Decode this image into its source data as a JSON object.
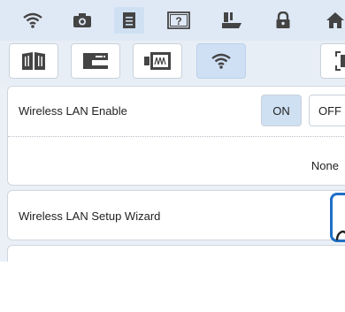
{
  "tabs": [
    {
      "icon": "wifi-icon",
      "active": false
    },
    {
      "icon": "camera-icon",
      "active": false
    },
    {
      "icon": "document-icon",
      "active": true
    },
    {
      "icon": "help-icon",
      "active": false
    },
    {
      "icon": "presser-foot-icon",
      "active": false
    },
    {
      "icon": "lock-icon",
      "active": false
    },
    {
      "icon": "home-icon",
      "active": false
    }
  ],
  "subtabs": [
    {
      "icon": "book-icon",
      "active": false
    },
    {
      "icon": "machine-icon",
      "active": false
    },
    {
      "icon": "embroidery-icon",
      "active": false
    },
    {
      "icon": "wifi-icon",
      "active": true
    },
    {
      "icon": "expand-icon",
      "active": false
    }
  ],
  "wireless_enable": {
    "label": "Wireless LAN Enable",
    "on_label": "ON",
    "off_label": "OFF",
    "value": "ON"
  },
  "network_status": {
    "value": "None"
  },
  "setup_wizard": {
    "label": "Wireless LAN Setup Wizard"
  },
  "colors": {
    "accent": "#cfe0f3",
    "blue_highlight": "#1f6fc5"
  }
}
